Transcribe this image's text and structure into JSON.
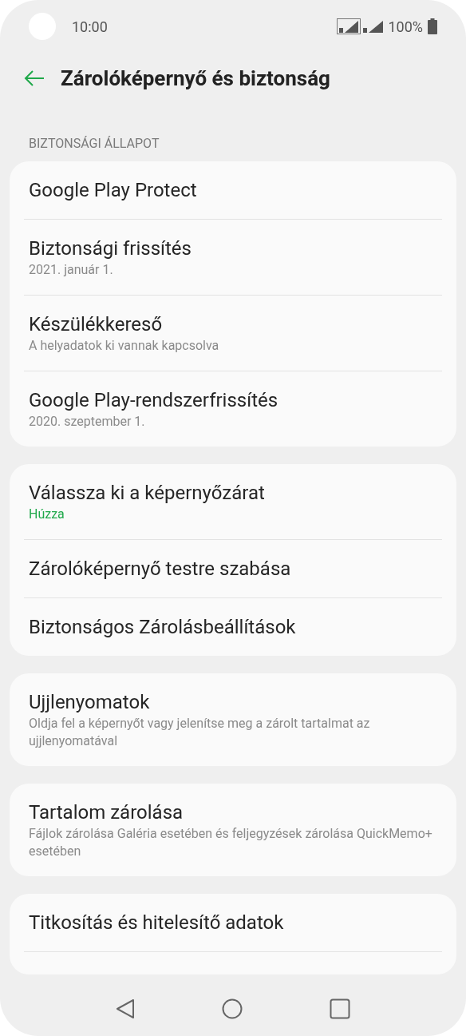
{
  "status_bar": {
    "time": "10:00",
    "battery": "100%"
  },
  "header": {
    "title": "Zárolóképernyő és biztonság"
  },
  "sections": [
    {
      "header": "BIZTONSÁGI ÁLLAPOT",
      "items": [
        {
          "title": "Google Play Protect"
        },
        {
          "title": "Biztonsági frissítés",
          "subtitle": "2021. január 1.",
          "kind": "normal"
        },
        {
          "title": "Készülékkereső",
          "subtitle": "A helyadatok ki vannak kapcsolva",
          "kind": "normal"
        },
        {
          "title": "Google Play-rendszerfrissítés",
          "subtitle": "2020. szeptember 1.",
          "kind": "normal"
        }
      ]
    },
    {
      "items": [
        {
          "title": "Válassza ki a képernyőzárat",
          "subtitle": "Húzza",
          "kind": "accent"
        },
        {
          "title": "Zárolóképernyő testre szabása"
        },
        {
          "title": "Biztonságos Zárolásbeállítások"
        }
      ]
    },
    {
      "items": [
        {
          "title": "Ujjlenyomatok",
          "subtitle": "Oldja fel a képernyőt vagy jelenítse meg a zárolt tartalmat az ujjlenyomatával",
          "kind": "normal"
        }
      ]
    },
    {
      "items": [
        {
          "title": "Tartalom zárolása",
          "subtitle": "Fájlok zárolása Galéria esetében és feljegyzések zárolása QuickMemo+ esetében",
          "kind": "normal"
        }
      ]
    },
    {
      "items": [
        {
          "title": "Titkosítás és hitelesítő adatok"
        }
      ],
      "continues": true
    }
  ]
}
